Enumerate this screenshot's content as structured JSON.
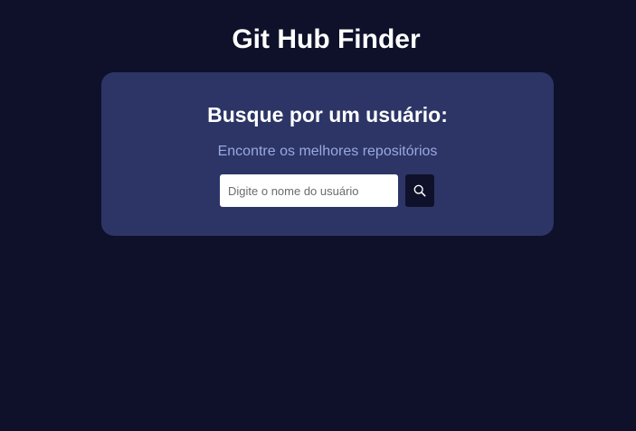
{
  "header": {
    "title": "Git Hub Finder"
  },
  "search_card": {
    "heading": "Busque por um usuário:",
    "subtitle": "Encontre os melhores repositórios",
    "input": {
      "value": "",
      "placeholder": "Digite o nome do usuário"
    },
    "button_icon": "search-icon"
  },
  "colors": {
    "page_background": "#0e1129",
    "card_background": "#2c3566",
    "subtitle": "#9ba7e0",
    "button_background": "#0e1129"
  }
}
